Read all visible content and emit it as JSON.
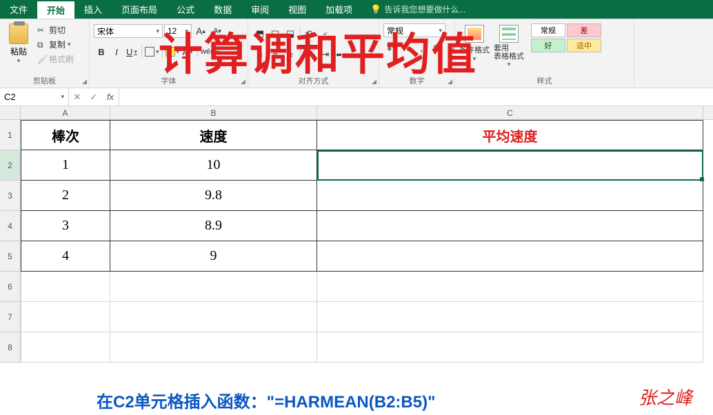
{
  "tabs": {
    "file": "文件",
    "home": "开始",
    "insert": "插入",
    "page_layout": "页面布局",
    "formulas": "公式",
    "data": "数据",
    "review": "审阅",
    "view": "视图",
    "addins": "加载项",
    "tell_me": "告诉我您想要做什么..."
  },
  "ribbon": {
    "clipboard": {
      "label": "剪贴板",
      "paste": "粘贴",
      "cut": "剪切",
      "copy": "复制",
      "format_painter": "格式刷"
    },
    "font": {
      "label": "字体",
      "name": "宋体",
      "size": "12",
      "increase": "A",
      "decrease": "A"
    },
    "alignment": {
      "label": "对齐方式"
    },
    "number": {
      "label": "数字",
      "format": "常规"
    },
    "styles": {
      "label": "样式",
      "cond_format": "条件格式",
      "table_format": "套用\n表格格式",
      "normal": "常规",
      "bad": "差",
      "good": "好",
      "neutral": "适中"
    }
  },
  "overlay_title": "计算调和平均值",
  "name_box": "C2",
  "formula": "",
  "columns": [
    "A",
    "B",
    "C"
  ],
  "rows": [
    "1",
    "2",
    "3",
    "4",
    "5",
    "6",
    "7",
    "8"
  ],
  "table": {
    "headers": {
      "A": "棒次",
      "B": "速度",
      "C": "平均速度"
    },
    "data": [
      {
        "A": "1",
        "B": "10"
      },
      {
        "A": "2",
        "B": "9.8"
      },
      {
        "A": "3",
        "B": "8.9"
      },
      {
        "A": "4",
        "B": "9"
      }
    ]
  },
  "instruction_prefix": "在C2单元格插入函数：\"",
  "instruction_formula": "=HARMEAN(B2:B5)",
  "instruction_suffix": "\"",
  "signature": "张之峰",
  "chart_data": {
    "type": "table",
    "title": "计算调和平均值",
    "columns": [
      "棒次",
      "速度",
      "平均速度"
    ],
    "rows": [
      [
        "1",
        10,
        null
      ],
      [
        "2",
        9.8,
        null
      ],
      [
        "3",
        8.9,
        null
      ],
      [
        "4",
        9,
        null
      ]
    ],
    "formula_hint": "=HARMEAN(B2:B5)"
  }
}
